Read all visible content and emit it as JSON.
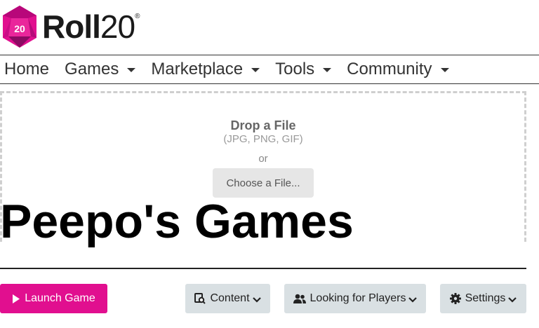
{
  "brand": {
    "logo_die_number": "20",
    "name_bold": "Roll",
    "name_light": "20",
    "trademark": "®",
    "brand_color": "#e10f8f"
  },
  "nav": {
    "items": [
      {
        "label": "Home",
        "has_dropdown": false
      },
      {
        "label": "Games",
        "has_dropdown": true
      },
      {
        "label": "Marketplace",
        "has_dropdown": true
      },
      {
        "label": "Tools",
        "has_dropdown": true
      },
      {
        "label": "Community",
        "has_dropdown": true
      }
    ]
  },
  "upload": {
    "title": "Drop a File",
    "types": "(JPG, PNG, GIF)",
    "or": "or",
    "choose_label": "Choose a File..."
  },
  "game": {
    "title": "Peepo's Games"
  },
  "actions": {
    "launch_label": "Launch Game",
    "content_label": "Content",
    "lfp_label": "Looking for Players",
    "settings_label": "Settings"
  },
  "icons": {
    "launch": "play-icon",
    "content": "content-icon",
    "lfp": "users-icon",
    "settings": "gear-icon",
    "dropdown": "chevron-down-icon"
  }
}
